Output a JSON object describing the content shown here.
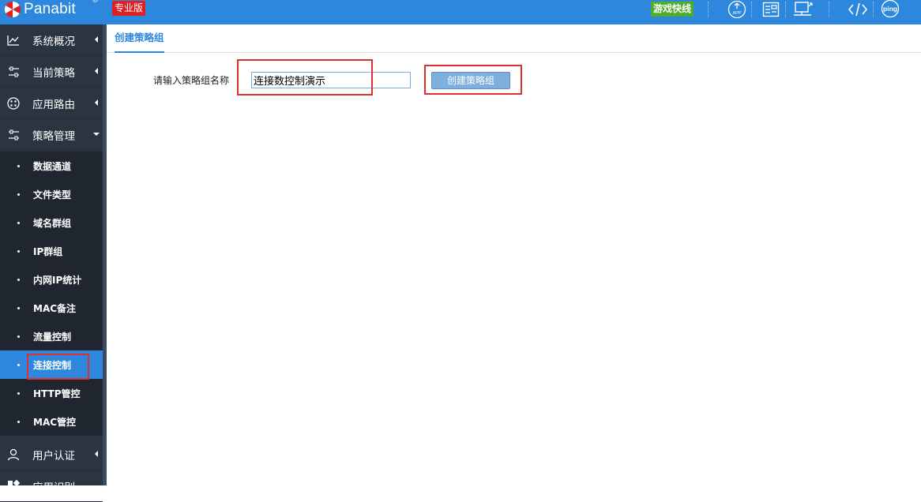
{
  "header": {
    "logo_text": "Panabit",
    "logo_reg": "®",
    "edition": "专业版",
    "game_accel": "游戏快线",
    "icons": [
      "app-icon",
      "list-icon",
      "export-icon",
      "code-icon",
      "ping-icon"
    ],
    "app_icon_text": "APP",
    "ping_icon_text": "ping"
  },
  "colors": {
    "topbar": "#2d88dd",
    "sidebar": "#2b3441",
    "active": "#2d88dd",
    "highlight": "#e03030"
  },
  "sidebar": {
    "main_items": [
      {
        "label": "系统概况",
        "icon": "chart-icon"
      },
      {
        "label": "当前策略",
        "icon": "sliders-icon"
      },
      {
        "label": "应用路由",
        "icon": "route-icon"
      },
      {
        "label": "策略管理",
        "icon": "sliders-icon"
      }
    ],
    "sub_items": [
      {
        "label": "数据通道"
      },
      {
        "label": "文件类型"
      },
      {
        "label": "域名群组"
      },
      {
        "label": "IP群组"
      },
      {
        "label": "内网IP统计"
      },
      {
        "label": "MAC备注"
      },
      {
        "label": "流量控制"
      },
      {
        "label": "连接控制"
      },
      {
        "label": "HTTP管控"
      },
      {
        "label": "MAC管控"
      }
    ],
    "bottom_items": [
      {
        "label": "用户认证",
        "icon": "user-icon"
      },
      {
        "label": "应用识别",
        "icon": "apps-icon"
      }
    ]
  },
  "main": {
    "tab_label": "创建策略组",
    "form": {
      "label": "请输入策略组名称",
      "value": "连接数控制演示",
      "button": "创建策略组"
    }
  }
}
